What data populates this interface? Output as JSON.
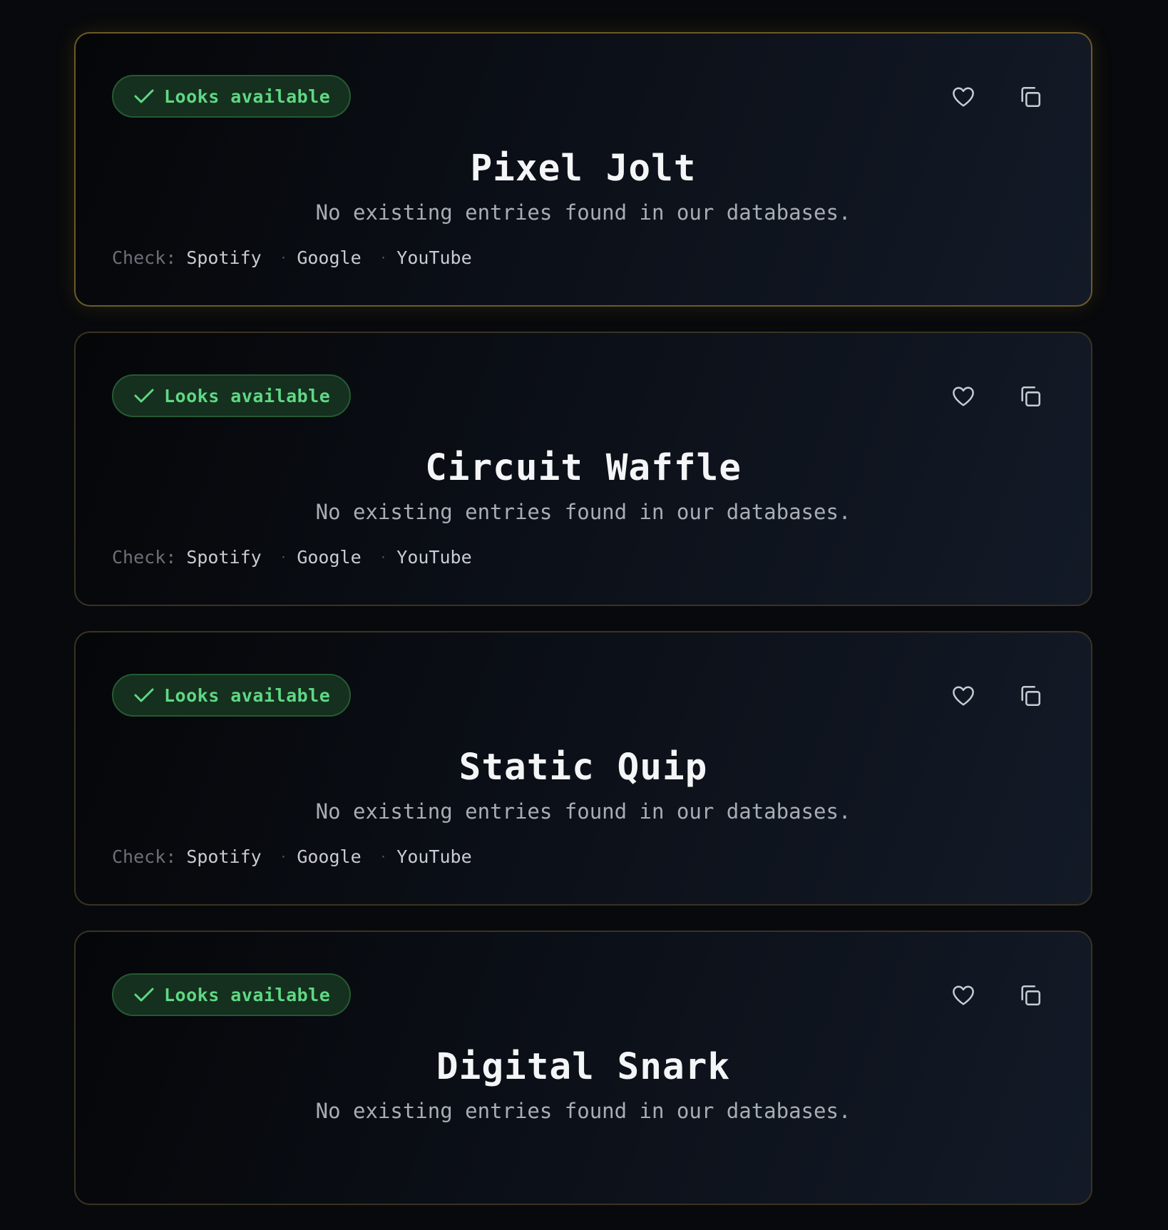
{
  "badge_label": "Looks available",
  "subtitle": "No existing entries found in our databases.",
  "check_label": "Check:",
  "separator": "·",
  "links": [
    "Spotify",
    "Google",
    "YouTube"
  ],
  "colors": {
    "accent_border": "#6e5a26",
    "available_text": "#5fd884",
    "available_bg": "#15301e"
  },
  "icons": {
    "status": "check-icon",
    "favorite": "heart-icon",
    "copy": "copy-icon"
  },
  "cards": [
    {
      "name": "Pixel Jolt",
      "highlighted": true
    },
    {
      "name": "Circuit Waffle",
      "highlighted": false
    },
    {
      "name": "Static Quip",
      "highlighted": false
    },
    {
      "name": "Digital Snark",
      "highlighted": false
    }
  ]
}
